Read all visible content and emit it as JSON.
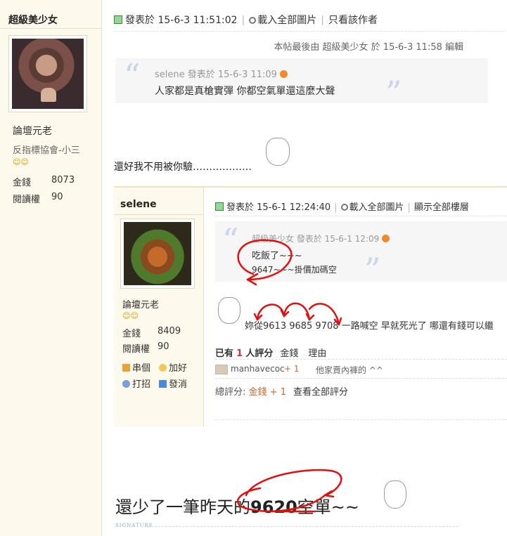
{
  "author1": {
    "name": "超級美少女",
    "rank": "論壇元老",
    "group": "反指標協會-小三",
    "smilies": "😊😊",
    "stats": [
      {
        "label": "金錢",
        "value": "8073"
      },
      {
        "label": "閱讀權",
        "value": "90"
      }
    ]
  },
  "post1": {
    "posted_at": "發表於  15-6-3 11:51:02",
    "load_images": "載入全部圖片",
    "author_only": "只看該作者",
    "edited": "本帖最後由 超級美少女 於 15-6-3 11:58 編輯",
    "quote_author": "selene 發表於 15-6-3 11:09",
    "quote_text": "人家都是真槍實彈 你都空氣單還這麼大聲",
    "reply": "還好我不用被你驗………………"
  },
  "author2": {
    "name": "selene",
    "rank": "論壇元老",
    "smilies": "😊😊",
    "stats": [
      {
        "label": "金錢",
        "value": "8409"
      },
      {
        "label": "閱讀權",
        "value": "90"
      }
    ],
    "actions": {
      "post_count": "串個",
      "like": "加好",
      "punch": "打招",
      "message": "發消"
    }
  },
  "post2": {
    "posted_at": "發表於  15-6-1 12:24:40",
    "load_images": "載入全部圖片",
    "show_all": "顯示全部樓層",
    "quote_author": "超級美少女  發表於 15-6-1 12:09",
    "quote_line1": "吃飯了~~~",
    "quote_line2": "9647~~~掛價加碼空",
    "message": "妳從9613 9685 9708 一路喊空  早就死光了  哪還有錢可以繼",
    "ratings_prefix": "已有",
    "ratings_count": "1",
    "ratings_suffix": "人評分",
    "ratings_col1": "金錢",
    "ratings_col2": "理由",
    "rater_name": "manhavecoc",
    "rater_score": "+ 1",
    "rater_reason": "他家賣內褲的 ^^",
    "total_label": "總評分:",
    "total_value": "金錢 + 1",
    "total_link": "查看全部評分"
  },
  "signature": {
    "line_before": "還少了一筆昨天的",
    "line_num": "9620",
    "line_after": "空單~~",
    "label": "SIGNATURE"
  },
  "colors": {
    "sidebar_bg": "#fdf9ec",
    "annotation_red": "#e01010",
    "quote_bg": "#f6f6f6"
  }
}
